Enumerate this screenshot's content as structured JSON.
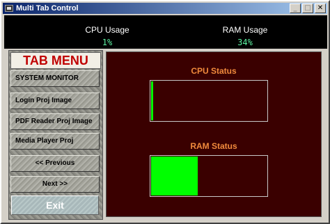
{
  "window": {
    "title": "Multi Tab Control",
    "buttons": {
      "minimize": "_",
      "maximize": "□",
      "close": "✕"
    }
  },
  "top": {
    "cpu_label": "CPU Usage",
    "cpu_value": "1%",
    "ram_label": "RAM Usage",
    "ram_value": "34%"
  },
  "menu": {
    "title": "TAB MENU",
    "items": [
      "SYSTEM MONITOR",
      "Login Proj Image",
      "PDF Reader Proj Image",
      "Media Player Proj",
      "<< Previous",
      "Next >>"
    ],
    "exit_label": "Exit"
  },
  "status": {
    "cpu_title": "CPU Status",
    "ram_title": "RAM Status",
    "cpu_percent": 1,
    "ram_percent": 34
  },
  "colors": {
    "status_bg": "#3a0000",
    "bar_fill": "#00ff00",
    "usage_value": "#5cf0a0",
    "status_title": "#f08a3c",
    "menu_title": "#c00000"
  }
}
